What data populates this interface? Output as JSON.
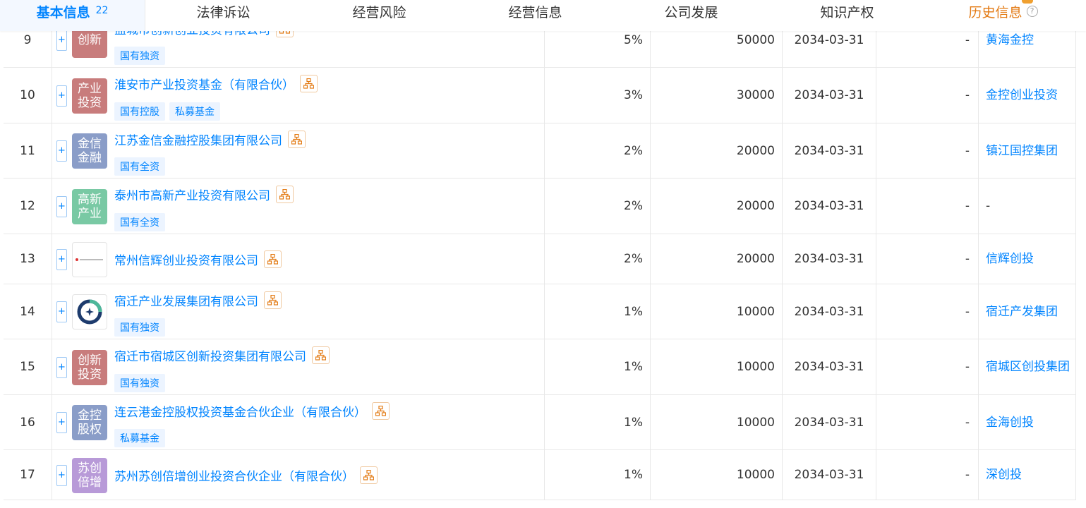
{
  "nav": {
    "tabs": [
      {
        "label": "基本信息",
        "count": "22",
        "active": true
      },
      {
        "label": "法律诉讼"
      },
      {
        "label": "经营风险"
      },
      {
        "label": "经营信息"
      },
      {
        "label": "公司发展"
      },
      {
        "label": "知识产权"
      },
      {
        "label": "历史信息",
        "help": "?"
      }
    ]
  },
  "colors": {
    "accent": "#0084ff",
    "history": "#e37a13"
  },
  "rows": [
    {
      "no": "9",
      "name": "盐城市创新创业投资有限公司",
      "logo_text": "创新",
      "logo_color": "#c87c7c",
      "tags": [
        "国有独资"
      ],
      "pct": "5%",
      "amount": "50000",
      "date": "2034-03-31",
      "dash": "-",
      "brand": "黄海金控"
    },
    {
      "no": "10",
      "name": "淮安市产业投资基金（有限合伙）",
      "logo_text": "产业投资",
      "logo_color": "#c87c7c",
      "tags": [
        "国有控股",
        "私募基金"
      ],
      "pct": "3%",
      "amount": "30000",
      "date": "2034-03-31",
      "dash": "-",
      "brand": "金控创业投资"
    },
    {
      "no": "11",
      "name": "江苏金信金融控股集团有限公司",
      "logo_text": "金信金融",
      "logo_color": "#8a9dc8",
      "tags": [
        "国有全资"
      ],
      "pct": "2%",
      "amount": "20000",
      "date": "2034-03-31",
      "dash": "-",
      "brand": "镇江国控集团"
    },
    {
      "no": "12",
      "name": "泰州市高新产业投资有限公司",
      "logo_text": "高新产业",
      "logo_color": "#79c9a4",
      "tags": [
        "国有全资"
      ],
      "pct": "2%",
      "amount": "20000",
      "date": "2034-03-31",
      "dash": "-",
      "brand": "-",
      "brand_plain": true
    },
    {
      "no": "13",
      "name": "常州信辉创业投资有限公司",
      "logo_text": "",
      "logo_type": "image-red",
      "tags": [],
      "pct": "2%",
      "amount": "20000",
      "date": "2034-03-31",
      "dash": "-",
      "brand": "信辉创投"
    },
    {
      "no": "14",
      "name": "宿迁产业发展集团有限公司",
      "logo_text": "",
      "logo_type": "image-ring",
      "tags": [
        "国有独资"
      ],
      "pct": "1%",
      "amount": "10000",
      "date": "2034-03-31",
      "dash": "-",
      "brand": "宿迁产发集团"
    },
    {
      "no": "15",
      "name": "宿迁市宿城区创新投资集团有限公司",
      "logo_text": "创新投资",
      "logo_color": "#c87c7c",
      "tags": [
        "国有独资"
      ],
      "pct": "1%",
      "amount": "10000",
      "date": "2034-03-31",
      "dash": "-",
      "brand": "宿城区创投集团"
    },
    {
      "no": "16",
      "name": "连云港金控股权投资基金合伙企业（有限合伙）",
      "logo_text": "金控股权",
      "logo_color": "#8a9dc8",
      "tags": [
        "私募基金"
      ],
      "pct": "1%",
      "amount": "10000",
      "date": "2034-03-31",
      "dash": "-",
      "brand": "金海创投"
    },
    {
      "no": "17",
      "name": "苏州苏创倍增创业投资合伙企业（有限合伙）",
      "logo_text": "苏创倍增",
      "logo_color": "#b89ad8",
      "tags": [],
      "pct": "1%",
      "amount": "10000",
      "date": "2034-03-31",
      "dash": "-",
      "brand": "深创投"
    }
  ]
}
